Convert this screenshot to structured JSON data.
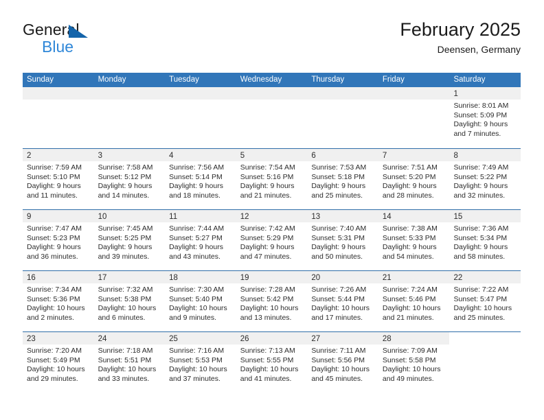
{
  "brand": {
    "name_dark": "General",
    "name_blue": "Blue",
    "accent_blue": "#2f87d8",
    "triangle_blue": "#1464aa"
  },
  "header": {
    "title": "February 2025",
    "location": "Deensen, Germany",
    "header_bg": "#3176b9",
    "separator_color": "#2e6da8",
    "daynum_band_bg": "#f0f0f0"
  },
  "weekdays": [
    "Sunday",
    "Monday",
    "Tuesday",
    "Wednesday",
    "Thursday",
    "Friday",
    "Saturday"
  ],
  "weeks": [
    {
      "days": [
        {
          "type": "empty"
        },
        {
          "type": "empty"
        },
        {
          "type": "empty"
        },
        {
          "type": "empty"
        },
        {
          "type": "empty"
        },
        {
          "type": "empty"
        },
        {
          "type": "day",
          "num": "1",
          "sunrise": "Sunrise: 8:01 AM",
          "sunset": "Sunset: 5:09 PM",
          "daylight1": "Daylight: 9 hours",
          "daylight2": "and 7 minutes."
        }
      ]
    },
    {
      "days": [
        {
          "type": "day",
          "num": "2",
          "sunrise": "Sunrise: 7:59 AM",
          "sunset": "Sunset: 5:10 PM",
          "daylight1": "Daylight: 9 hours",
          "daylight2": "and 11 minutes."
        },
        {
          "type": "day",
          "num": "3",
          "sunrise": "Sunrise: 7:58 AM",
          "sunset": "Sunset: 5:12 PM",
          "daylight1": "Daylight: 9 hours",
          "daylight2": "and 14 minutes."
        },
        {
          "type": "day",
          "num": "4",
          "sunrise": "Sunrise: 7:56 AM",
          "sunset": "Sunset: 5:14 PM",
          "daylight1": "Daylight: 9 hours",
          "daylight2": "and 18 minutes."
        },
        {
          "type": "day",
          "num": "5",
          "sunrise": "Sunrise: 7:54 AM",
          "sunset": "Sunset: 5:16 PM",
          "daylight1": "Daylight: 9 hours",
          "daylight2": "and 21 minutes."
        },
        {
          "type": "day",
          "num": "6",
          "sunrise": "Sunrise: 7:53 AM",
          "sunset": "Sunset: 5:18 PM",
          "daylight1": "Daylight: 9 hours",
          "daylight2": "and 25 minutes."
        },
        {
          "type": "day",
          "num": "7",
          "sunrise": "Sunrise: 7:51 AM",
          "sunset": "Sunset: 5:20 PM",
          "daylight1": "Daylight: 9 hours",
          "daylight2": "and 28 minutes."
        },
        {
          "type": "day",
          "num": "8",
          "sunrise": "Sunrise: 7:49 AM",
          "sunset": "Sunset: 5:22 PM",
          "daylight1": "Daylight: 9 hours",
          "daylight2": "and 32 minutes."
        }
      ]
    },
    {
      "days": [
        {
          "type": "day",
          "num": "9",
          "sunrise": "Sunrise: 7:47 AM",
          "sunset": "Sunset: 5:23 PM",
          "daylight1": "Daylight: 9 hours",
          "daylight2": "and 36 minutes."
        },
        {
          "type": "day",
          "num": "10",
          "sunrise": "Sunrise: 7:45 AM",
          "sunset": "Sunset: 5:25 PM",
          "daylight1": "Daylight: 9 hours",
          "daylight2": "and 39 minutes."
        },
        {
          "type": "day",
          "num": "11",
          "sunrise": "Sunrise: 7:44 AM",
          "sunset": "Sunset: 5:27 PM",
          "daylight1": "Daylight: 9 hours",
          "daylight2": "and 43 minutes."
        },
        {
          "type": "day",
          "num": "12",
          "sunrise": "Sunrise: 7:42 AM",
          "sunset": "Sunset: 5:29 PM",
          "daylight1": "Daylight: 9 hours",
          "daylight2": "and 47 minutes."
        },
        {
          "type": "day",
          "num": "13",
          "sunrise": "Sunrise: 7:40 AM",
          "sunset": "Sunset: 5:31 PM",
          "daylight1": "Daylight: 9 hours",
          "daylight2": "and 50 minutes."
        },
        {
          "type": "day",
          "num": "14",
          "sunrise": "Sunrise: 7:38 AM",
          "sunset": "Sunset: 5:33 PM",
          "daylight1": "Daylight: 9 hours",
          "daylight2": "and 54 minutes."
        },
        {
          "type": "day",
          "num": "15",
          "sunrise": "Sunrise: 7:36 AM",
          "sunset": "Sunset: 5:34 PM",
          "daylight1": "Daylight: 9 hours",
          "daylight2": "and 58 minutes."
        }
      ]
    },
    {
      "days": [
        {
          "type": "day",
          "num": "16",
          "sunrise": "Sunrise: 7:34 AM",
          "sunset": "Sunset: 5:36 PM",
          "daylight1": "Daylight: 10 hours",
          "daylight2": "and 2 minutes."
        },
        {
          "type": "day",
          "num": "17",
          "sunrise": "Sunrise: 7:32 AM",
          "sunset": "Sunset: 5:38 PM",
          "daylight1": "Daylight: 10 hours",
          "daylight2": "and 6 minutes."
        },
        {
          "type": "day",
          "num": "18",
          "sunrise": "Sunrise: 7:30 AM",
          "sunset": "Sunset: 5:40 PM",
          "daylight1": "Daylight: 10 hours",
          "daylight2": "and 9 minutes."
        },
        {
          "type": "day",
          "num": "19",
          "sunrise": "Sunrise: 7:28 AM",
          "sunset": "Sunset: 5:42 PM",
          "daylight1": "Daylight: 10 hours",
          "daylight2": "and 13 minutes."
        },
        {
          "type": "day",
          "num": "20",
          "sunrise": "Sunrise: 7:26 AM",
          "sunset": "Sunset: 5:44 PM",
          "daylight1": "Daylight: 10 hours",
          "daylight2": "and 17 minutes."
        },
        {
          "type": "day",
          "num": "21",
          "sunrise": "Sunrise: 7:24 AM",
          "sunset": "Sunset: 5:46 PM",
          "daylight1": "Daylight: 10 hours",
          "daylight2": "and 21 minutes."
        },
        {
          "type": "day",
          "num": "22",
          "sunrise": "Sunrise: 7:22 AM",
          "sunset": "Sunset: 5:47 PM",
          "daylight1": "Daylight: 10 hours",
          "daylight2": "and 25 minutes."
        }
      ]
    },
    {
      "days": [
        {
          "type": "day",
          "num": "23",
          "sunrise": "Sunrise: 7:20 AM",
          "sunset": "Sunset: 5:49 PM",
          "daylight1": "Daylight: 10 hours",
          "daylight2": "and 29 minutes."
        },
        {
          "type": "day",
          "num": "24",
          "sunrise": "Sunrise: 7:18 AM",
          "sunset": "Sunset: 5:51 PM",
          "daylight1": "Daylight: 10 hours",
          "daylight2": "and 33 minutes."
        },
        {
          "type": "day",
          "num": "25",
          "sunrise": "Sunrise: 7:16 AM",
          "sunset": "Sunset: 5:53 PM",
          "daylight1": "Daylight: 10 hours",
          "daylight2": "and 37 minutes."
        },
        {
          "type": "day",
          "num": "26",
          "sunrise": "Sunrise: 7:13 AM",
          "sunset": "Sunset: 5:55 PM",
          "daylight1": "Daylight: 10 hours",
          "daylight2": "and 41 minutes."
        },
        {
          "type": "day",
          "num": "27",
          "sunrise": "Sunrise: 7:11 AM",
          "sunset": "Sunset: 5:56 PM",
          "daylight1": "Daylight: 10 hours",
          "daylight2": "and 45 minutes."
        },
        {
          "type": "day",
          "num": "28",
          "sunrise": "Sunrise: 7:09 AM",
          "sunset": "Sunset: 5:58 PM",
          "daylight1": "Daylight: 10 hours",
          "daylight2": "and 49 minutes."
        },
        {
          "type": "blank"
        }
      ]
    }
  ]
}
